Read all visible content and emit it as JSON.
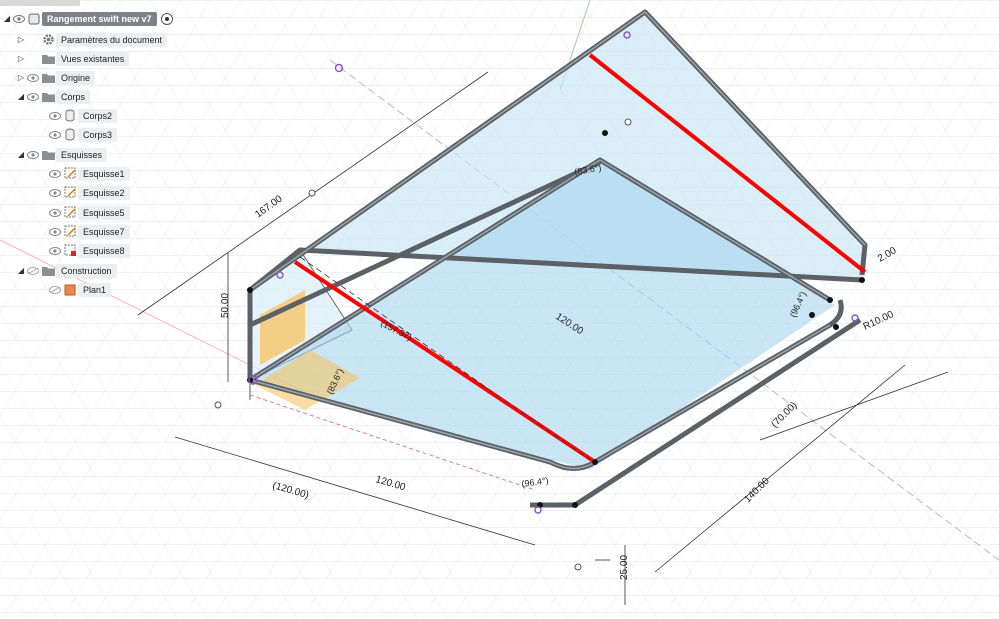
{
  "browser": {
    "root": {
      "label": "Rangement swift new v7"
    },
    "items": [
      {
        "label": "Paramètres du document",
        "icon": "gear-icon"
      },
      {
        "label": "Vues existantes",
        "icon": "folder-icon"
      },
      {
        "label": "Origine",
        "icon": "folder-icon"
      },
      {
        "label": "Corps",
        "icon": "folder-icon"
      },
      {
        "label": "Corps2",
        "icon": "body-icon"
      },
      {
        "label": "Corps3",
        "icon": "body-icon"
      },
      {
        "label": "Esquisses",
        "icon": "folder-icon"
      },
      {
        "label": "Esquisse1",
        "icon": "sketch-icon"
      },
      {
        "label": "Esquisse2",
        "icon": "sketch-icon"
      },
      {
        "label": "Esquisse5",
        "icon": "sketch-icon"
      },
      {
        "label": "Esquisse7",
        "icon": "sketch-icon"
      },
      {
        "label": "Esquisse8",
        "icon": "sketch-locked-icon"
      },
      {
        "label": "Construction",
        "icon": "folder-icon"
      },
      {
        "label": "Plan1",
        "icon": "plane-icon"
      }
    ]
  },
  "dimensions": {
    "d167": "167.00",
    "d50": "50.00",
    "d83_6": "(83.6°)",
    "d2": "2.00",
    "dR10": "R10.00",
    "d120a": "120.00",
    "d70": "(70.00)",
    "d140": "140.00",
    "d120b": "120.00",
    "d120p": "(120.00)",
    "d25": "25.00",
    "d96": "(96.4°)",
    "d83b": "(83.6°)",
    "d157": "(157.37)",
    "d96b": "(96.4°)"
  },
  "colors": {
    "accent_red": "#ff0000",
    "panel_fill": "#bfe2f3",
    "frame": "#5e6468",
    "plane_orange": "#f5b23c"
  }
}
